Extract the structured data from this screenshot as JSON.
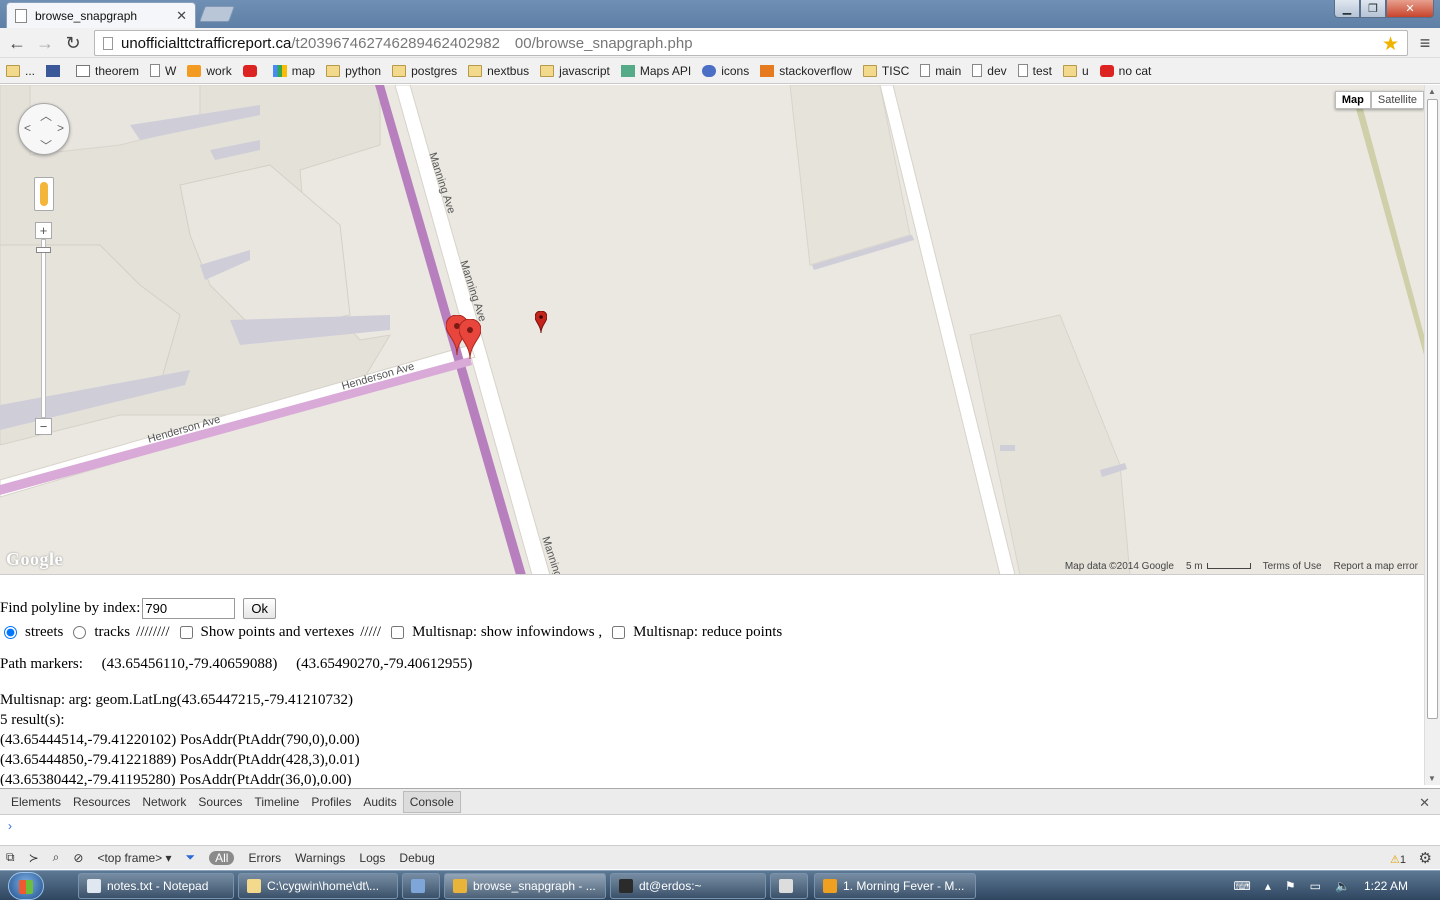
{
  "browser": {
    "tab_title": "browse_snapgraph",
    "url_domain": "unofficialttctrafficreport.ca",
    "url_path": "/t203967462746289462402982 00/browse_snapgraph.php"
  },
  "bookmarks": [
    {
      "label": "...",
      "icon": "folder-icon"
    },
    {
      "label": "",
      "icon": "facebook-icon"
    },
    {
      "label": "theorem",
      "icon": "mail-icon"
    },
    {
      "label": "W",
      "icon": "page-icon"
    },
    {
      "label": "work",
      "icon": "cp-icon"
    },
    {
      "label": "",
      "icon": "youtube-icon"
    },
    {
      "label": "map",
      "icon": "maps-icon"
    },
    {
      "label": "python",
      "icon": "folder-icon"
    },
    {
      "label": "postgres",
      "icon": "folder-icon"
    },
    {
      "label": "nextbus",
      "icon": "folder-icon"
    },
    {
      "label": "javascript",
      "icon": "folder-icon"
    },
    {
      "label": "Maps API",
      "icon": "mapsapi-icon"
    },
    {
      "label": "icons",
      "icon": "icons-icon"
    },
    {
      "label": "stackoverflow",
      "icon": "stackoverflow-icon"
    },
    {
      "label": "TISC",
      "icon": "folder-icon"
    },
    {
      "label": "main",
      "icon": "page-icon"
    },
    {
      "label": "dev",
      "icon": "page-icon"
    },
    {
      "label": "test",
      "icon": "page-icon"
    },
    {
      "label": "u",
      "icon": "folder-icon"
    },
    {
      "label": "no cat",
      "icon": "youtube-icon"
    }
  ],
  "map": {
    "type_map": "Map",
    "type_satellite": "Satellite",
    "logo": "Google",
    "street_labels": [
      "Manning Ave",
      "Manning Ave",
      "Manning",
      "Henderson Ave",
      "Henderson Ave"
    ],
    "footer": {
      "data": "Map data ©2014 Google",
      "scale": "5 m",
      "terms": "Terms of Use",
      "report": "Report a map error"
    }
  },
  "form": {
    "find_label": "Find polyline by index:",
    "find_value": "790",
    "ok_label": "Ok",
    "radio_streets": "streets",
    "radio_tracks": "tracks",
    "sep1": "////////",
    "show_points": "Show points and vertexes",
    "sep2": "/////",
    "multisnap_info": "Multisnap: show infowindows ,",
    "multisnap_reduce": "Multisnap: reduce points"
  },
  "output": {
    "path_markers_label": "Path markers:",
    "path_marker_1": "(43.65456110,-79.40659088)",
    "path_marker_2": "(43.65490270,-79.40612955)",
    "multisnap_arg": "Multisnap: arg: geom.LatLng(43.65447215,-79.41210732)",
    "result_count": "5 result(s):",
    "results": [
      "(43.65444514,-79.41220102) PosAddr(PtAddr(790,0),0.00)",
      "(43.65444850,-79.41221889) PosAddr(PtAddr(428,3),0.01)",
      "(43.65380442,-79.41195280) PosAddr(PtAddr(36,0),0.00)"
    ]
  },
  "devtools": {
    "tabs": [
      "Elements",
      "Resources",
      "Network",
      "Sources",
      "Timeline",
      "Profiles",
      "Audits",
      "Console"
    ],
    "selected_tab": "Console",
    "frame": "<top frame>",
    "filters": [
      "All",
      "Errors",
      "Warnings",
      "Logs",
      "Debug"
    ],
    "warning_count": "1"
  },
  "taskbar": {
    "items": [
      {
        "label": "notes.txt - Notepad"
      },
      {
        "label": "C:\\cygwin\\home\\dt\\..."
      },
      {
        "label": ""
      },
      {
        "label": "browse_snapgraph - ..."
      },
      {
        "label": "dt@erdos:~"
      },
      {
        "label": ""
      },
      {
        "label": "1. Morning Fever - M..."
      }
    ],
    "clock": "1:22 AM"
  },
  "colors": {
    "streetcar_line": "#b77fbd",
    "map_bg": "#ebe8e1",
    "marker": "#e8453c"
  }
}
